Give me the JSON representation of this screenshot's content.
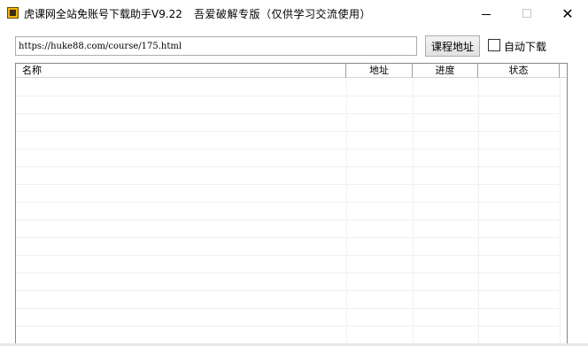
{
  "window": {
    "title": "虎课网全站免账号下载助手V9.22",
    "subtitle": "吾爱破解专版（仅供学习交流使用）",
    "minimize_icon": "minimize-icon",
    "maximize_icon": "maximize-icon",
    "close_symbol": "✕"
  },
  "toolbar": {
    "url_value": "https://huke88.com/course/175.html",
    "course_button_label": "课程地址",
    "auto_download_label": "自动下载",
    "auto_download_checked": false
  },
  "list": {
    "columns": [
      "名称",
      "地址",
      "进度",
      "状态"
    ],
    "rows": []
  },
  "colors": {
    "accent": "#f0b400",
    "border": "#828790"
  }
}
